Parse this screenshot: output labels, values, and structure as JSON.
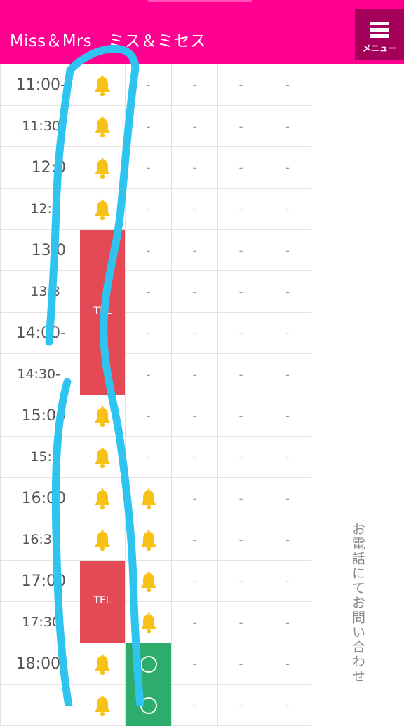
{
  "header": {
    "title": "Miss＆Mrs　ミス＆ミセス",
    "menu_label": "メニュー"
  },
  "colors": {
    "brand": "#ff0090",
    "menu_bg": "#a50059",
    "tel_bg": "#e44a55",
    "bell": "#f8c116",
    "available_bg": "#2dac6c",
    "annotation": "#2fc3f0"
  },
  "schedule": {
    "rows": [
      {
        "time": "11:00-",
        "cells": [
          "bell",
          "-",
          "-",
          "-",
          "-"
        ]
      },
      {
        "time": "11:30",
        "cells": [
          "bell",
          "-",
          "-",
          "-",
          "-"
        ]
      },
      {
        "time": "12:0",
        "cells": [
          "bell",
          "-",
          "-",
          "-",
          "-"
        ]
      },
      {
        "time": "12:3",
        "cells": [
          "bell",
          "-",
          "-",
          "-",
          "-"
        ]
      },
      {
        "time": "13:0",
        "cells": [
          "tel",
          "-",
          "-",
          "-",
          "-"
        ]
      },
      {
        "time": "13:3",
        "cells": [
          "tel",
          "-",
          "-",
          "-",
          "-"
        ]
      },
      {
        "time": "14:00-",
        "cells": [
          "tel",
          "-",
          "-",
          "-",
          "-"
        ]
      },
      {
        "time": "14:30-",
        "cells": [
          "tel",
          "-",
          "-",
          "-",
          "-"
        ]
      },
      {
        "time": "15:00",
        "cells": [
          "bell",
          "-",
          "-",
          "-",
          "-"
        ]
      },
      {
        "time": "15:3",
        "cells": [
          "bell",
          "-",
          "-",
          "-",
          "-"
        ]
      },
      {
        "time": "16:00",
        "cells": [
          "bell",
          "bell",
          "-",
          "-",
          "-"
        ]
      },
      {
        "time": "16:30",
        "cells": [
          "bell",
          "bell",
          "-",
          "-",
          "-"
        ]
      },
      {
        "time": "17:00",
        "cells": [
          "tel",
          "bell",
          "-",
          "-",
          "-"
        ]
      },
      {
        "time": "17:30",
        "cells": [
          "tel",
          "bell",
          "-",
          "-",
          "-"
        ]
      },
      {
        "time": "18:00-",
        "cells": [
          "bell",
          "available",
          "-",
          "-",
          "-"
        ]
      },
      {
        "time": "",
        "cells": [
          "bell",
          "available",
          "-",
          "-",
          "-"
        ]
      }
    ],
    "tel_label": "TEL",
    "dash": "-"
  },
  "side_note": "お電話にてお問い合わせ",
  "icons": {
    "menu": "hamburger-menu-icon",
    "waitlist": "bell-icon",
    "available": "circle-icon"
  }
}
